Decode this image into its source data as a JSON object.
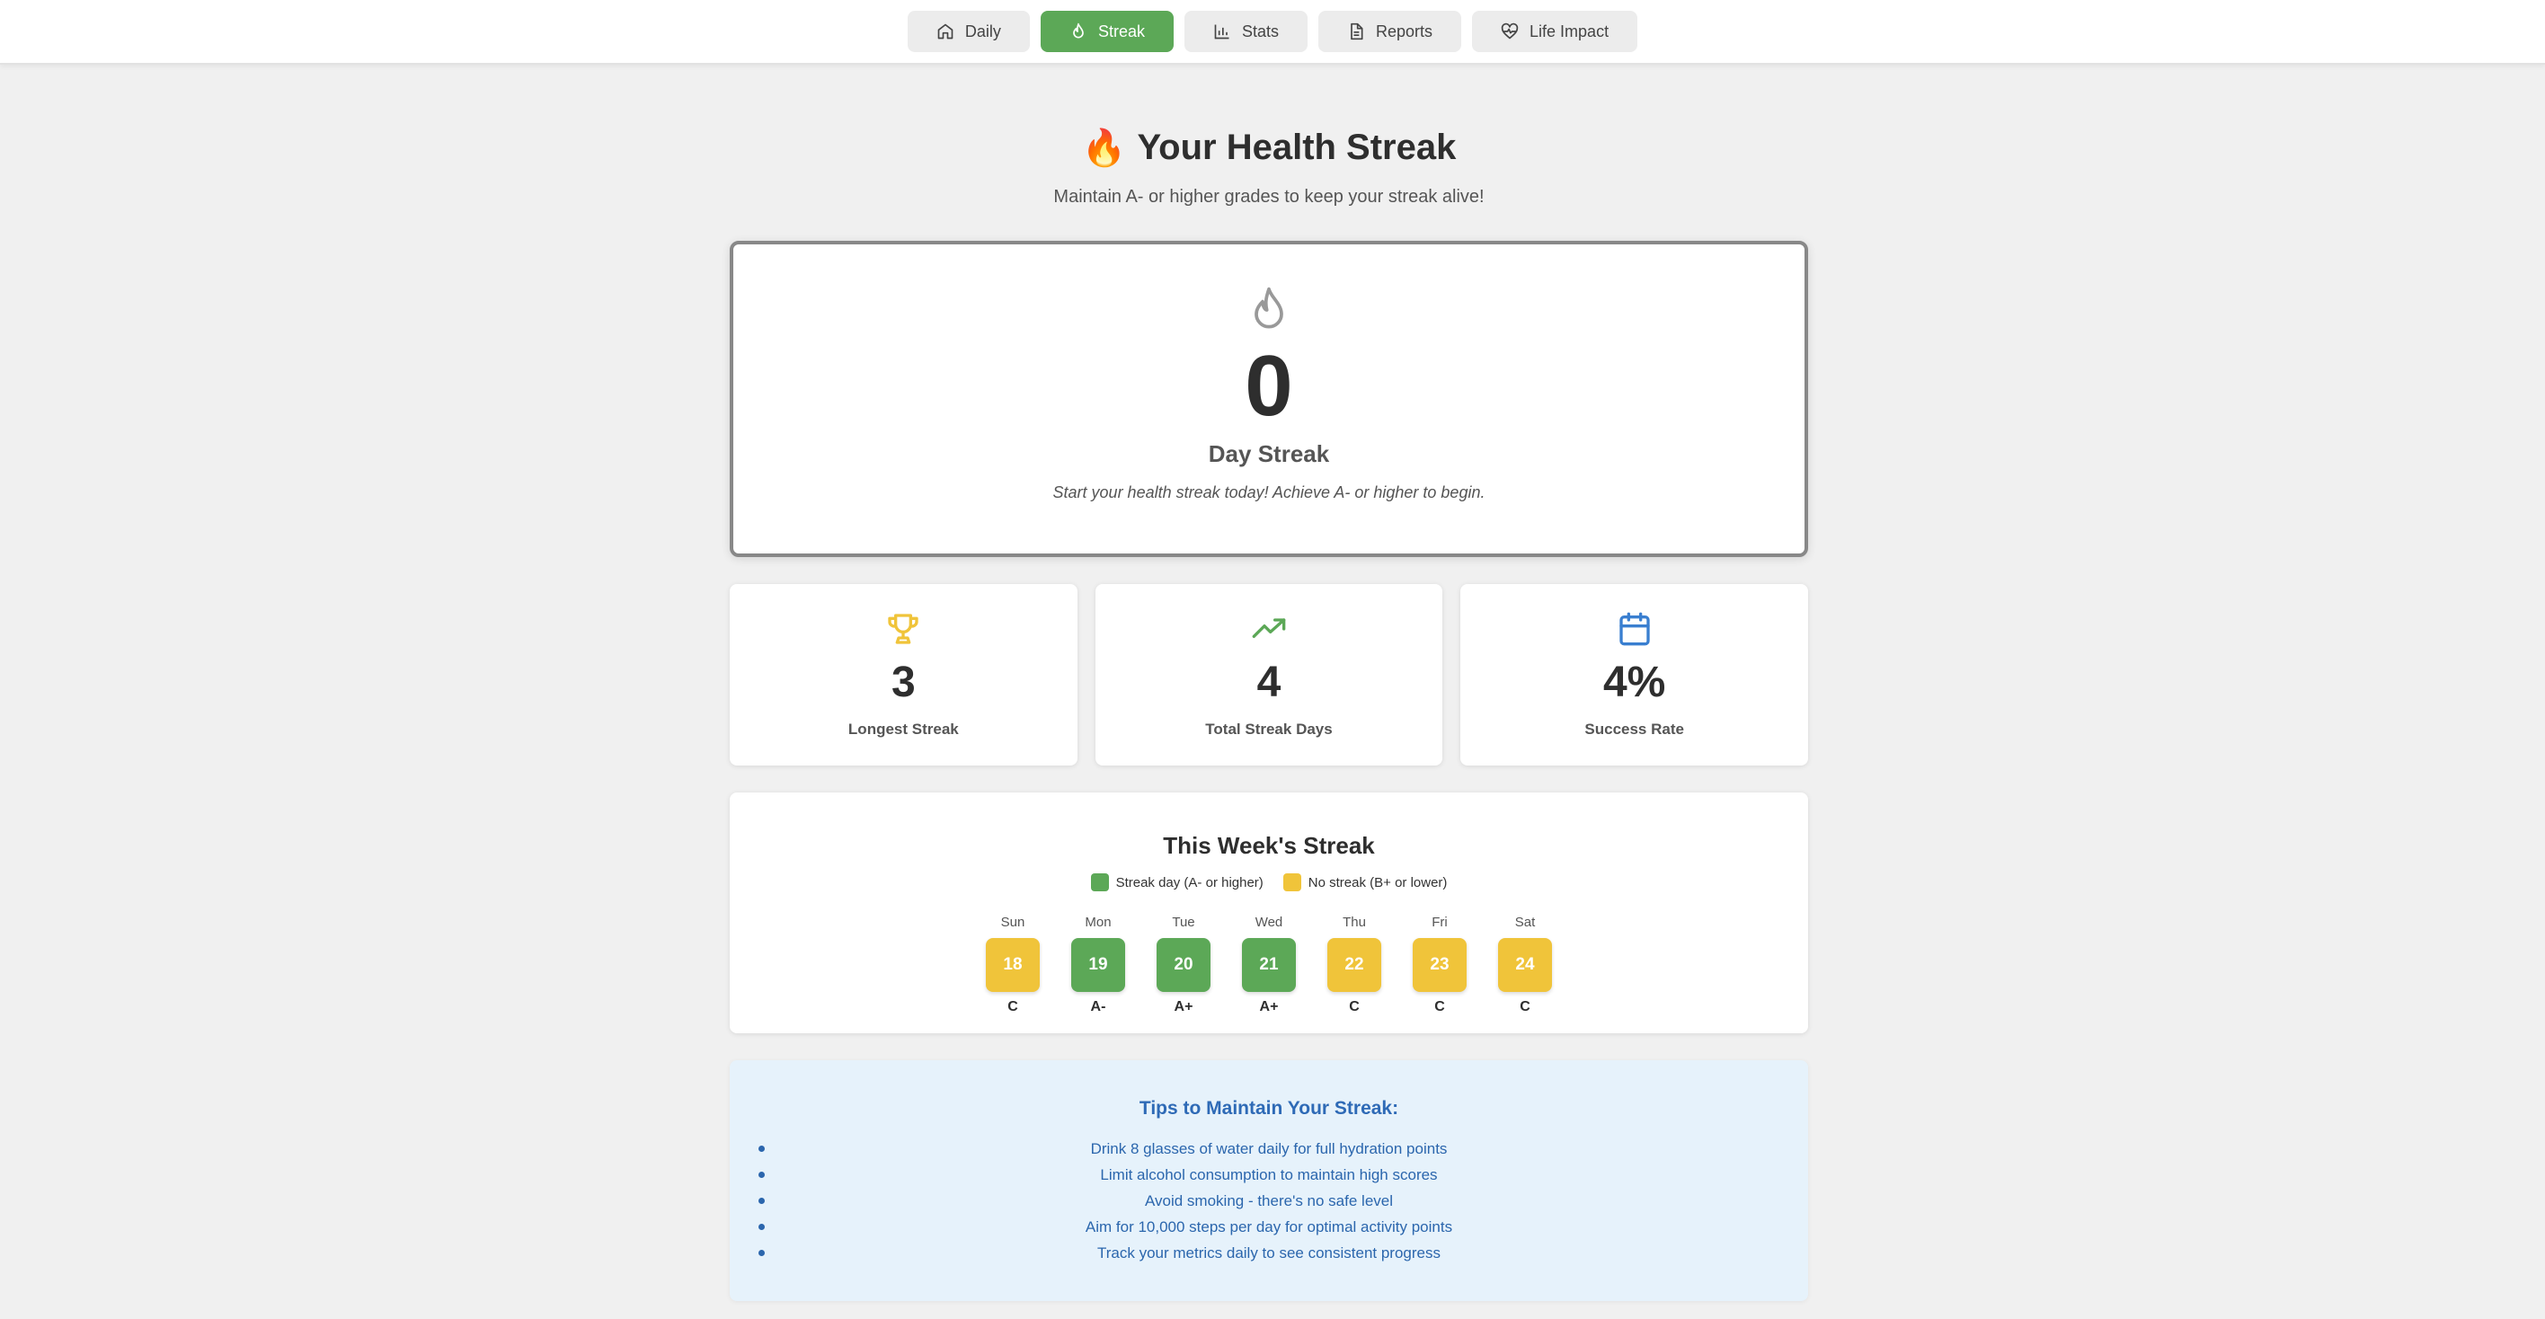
{
  "nav": {
    "tabs": [
      {
        "label": "Daily",
        "icon": "home-icon",
        "active": false
      },
      {
        "label": "Streak",
        "icon": "flame-icon",
        "active": true
      },
      {
        "label": "Stats",
        "icon": "bar-chart-icon",
        "active": false
      },
      {
        "label": "Reports",
        "icon": "document-icon",
        "active": false
      },
      {
        "label": "Life Impact",
        "icon": "heart-pulse-icon",
        "active": false
      }
    ]
  },
  "header": {
    "emoji": "🔥",
    "title": "Your Health Streak",
    "subtitle": "Maintain A- or higher grades to keep your streak alive!"
  },
  "streak": {
    "count": "0",
    "label": "Day Streak",
    "message": "Start your health streak today! Achieve A- or higher to begin."
  },
  "stats": [
    {
      "value": "3",
      "label": "Longest Streak",
      "icon": "trophy-icon",
      "color": "#f0c43a"
    },
    {
      "value": "4",
      "label": "Total Streak Days",
      "icon": "trending-up-icon",
      "color": "#5ca857"
    },
    {
      "value": "4%",
      "label": "Success Rate",
      "icon": "calendar-icon",
      "color": "#3a7fd0"
    }
  ],
  "week": {
    "title": "This Week's Streak",
    "legend": [
      {
        "label": "Streak day (A- or higher)",
        "color": "#5ca857"
      },
      {
        "label": "No streak (B+ or lower)",
        "color": "#f0c43a"
      }
    ],
    "days": [
      {
        "name": "Sun",
        "date": "18",
        "grade": "C",
        "streak": false
      },
      {
        "name": "Mon",
        "date": "19",
        "grade": "A-",
        "streak": true
      },
      {
        "name": "Tue",
        "date": "20",
        "grade": "A+",
        "streak": true
      },
      {
        "name": "Wed",
        "date": "21",
        "grade": "A+",
        "streak": true
      },
      {
        "name": "Thu",
        "date": "22",
        "grade": "C",
        "streak": false
      },
      {
        "name": "Fri",
        "date": "23",
        "grade": "C",
        "streak": false
      },
      {
        "name": "Sat",
        "date": "24",
        "grade": "C",
        "streak": false
      }
    ]
  },
  "tips": {
    "title": "Tips to Maintain Your Streak:",
    "items": [
      "Drink 8 glasses of water daily for full hydration points",
      "Limit alcohol consumption to maintain high scores",
      "Avoid smoking - there's no safe level",
      "Aim for 10,000 steps per day for optimal activity points",
      "Track your metrics daily to see consistent progress"
    ]
  },
  "colors": {
    "streak_green": "#5ca857",
    "no_streak_yellow": "#f0c43a",
    "tips_blue": "#2b66ad"
  }
}
